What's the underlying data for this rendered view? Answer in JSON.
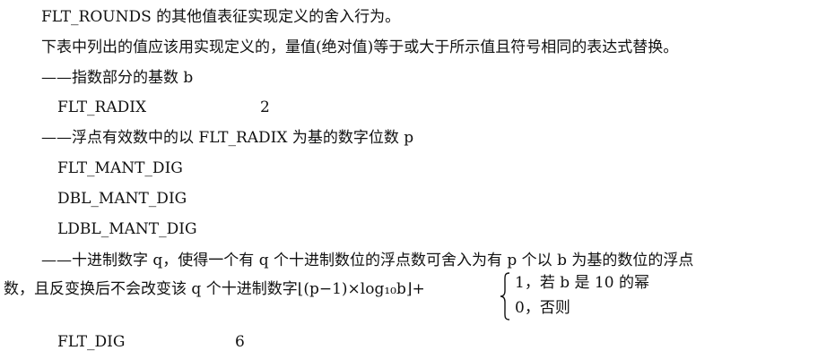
{
  "text": {
    "line1": "FLT_ROUNDS 的其他值表征实现定义的舍入行为。",
    "line2": "下表中列出的值应该用实现定义的，量值(绝对值)等于或大于所示值且符号相同的表达式替换。",
    "line3": "——指数部分的基数 b",
    "line4_name": "FLT_RADIX",
    "line4_value": "2",
    "line5": "——浮点有效数中的以 FLT_RADIX 为基的数字位数 p",
    "line6": "FLT_MANT_DIG",
    "line7": "DBL_MANT_DIG",
    "line8": "LDBL_MANT_DIG",
    "line9": "——十进制数字 q，使得一个有 q 个十进制数位的浮点数可舍入为有 p 个以 b 为基的数位的浮点",
    "line10": "数，且反变换后不会改变该 q 个十进制数字⌊(p−1)×log₁₀b⌋+",
    "case1": "1，若 b 是 10 的幂",
    "case2": "0，否则",
    "line11_name": "FLT_DIG",
    "line11_value": "6"
  }
}
